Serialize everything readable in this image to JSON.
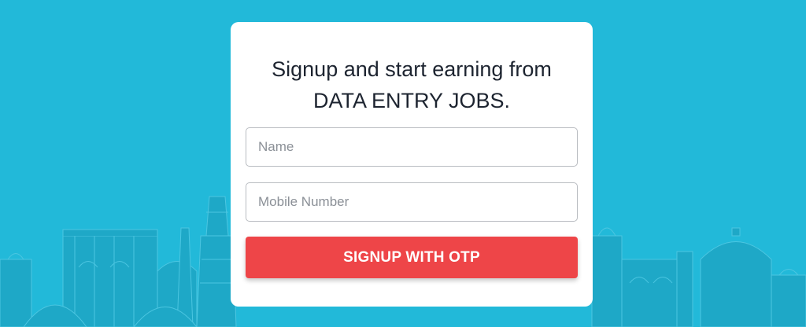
{
  "theme": {
    "background": "#22b9d9",
    "skyline": "#1ea8c7",
    "card": "#ffffff",
    "button": "#ee4548",
    "heading_text": "#1d2430"
  },
  "signup_card": {
    "heading_line1": "Signup and start earning from",
    "heading_line2": "DATA ENTRY JOBS.",
    "name_placeholder": "Name",
    "mobile_placeholder": "Mobile Number",
    "submit_label": "SIGNUP WITH OTP"
  },
  "background_image": {
    "icon": "city-skyline-illustration"
  }
}
